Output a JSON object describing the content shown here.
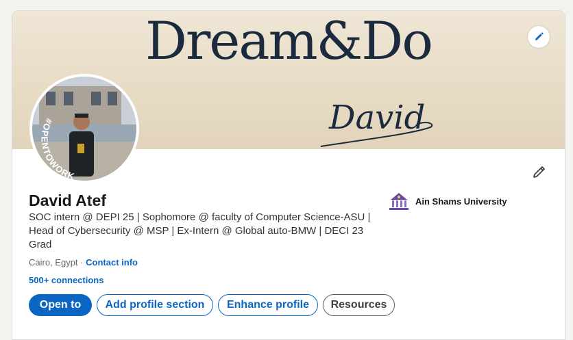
{
  "banner": {
    "title": "Dream&Do",
    "signature": "David"
  },
  "profile": {
    "badge_text": "#OPENTOWORK",
    "name": "David Atef",
    "headline": "SOC intern @ DEPI 25 | Sophomore @ faculty of Computer Science-ASU | Head of Cybersecurity @ MSP | Ex-Intern @ Global auto-BMW | DECI 23 Grad",
    "location": "Cairo, Egypt",
    "separator": "·",
    "contact_label": "Contact info",
    "connections": "500+ connections"
  },
  "education": {
    "name": "Ain Shams University"
  },
  "actions": {
    "open_to": "Open to",
    "add_section": "Add profile section",
    "enhance": "Enhance profile",
    "resources": "Resources"
  },
  "colors": {
    "primary": "#0a66c2",
    "open_to_work_green": "#2f7d32"
  }
}
